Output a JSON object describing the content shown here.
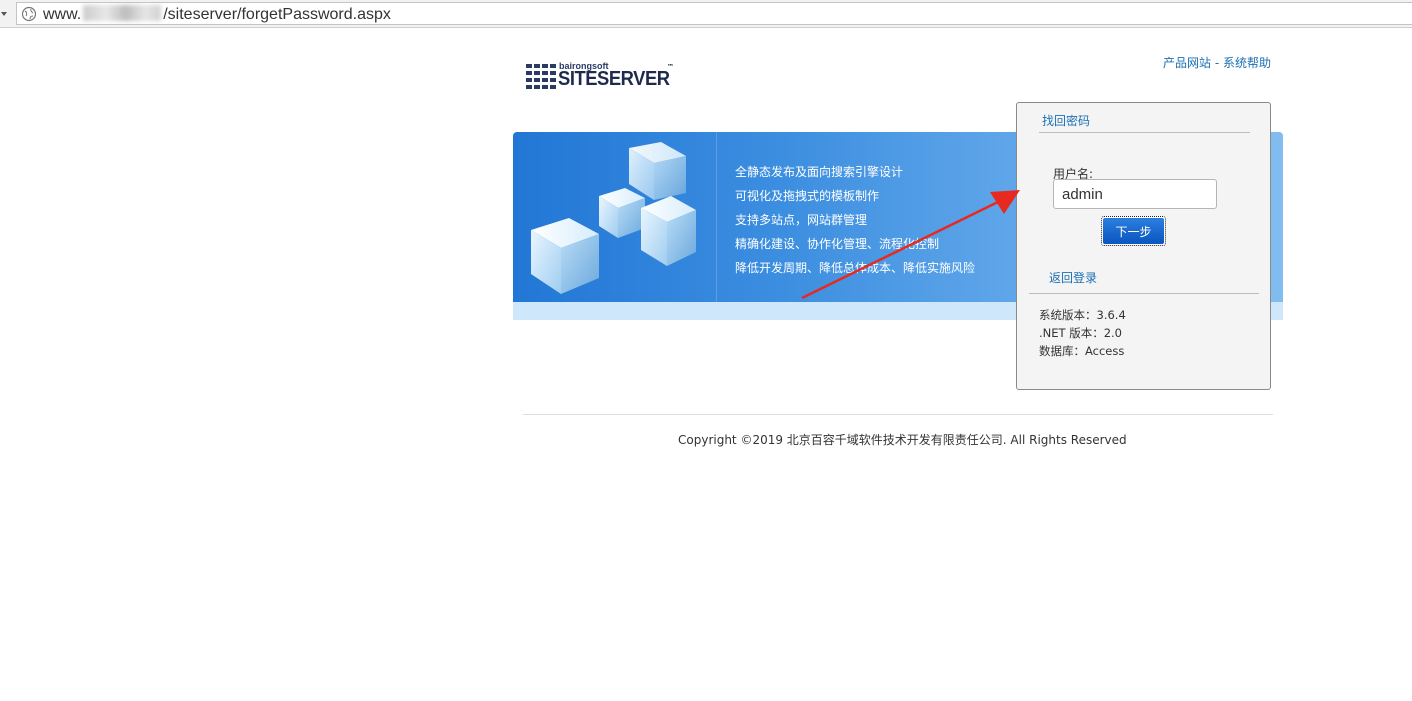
{
  "address_bar": {
    "url_prefix": "www.",
    "url_suffix": "/siteserver/forgetPassword.aspx"
  },
  "top_links": {
    "product_site": "产品网站",
    "separator": " - ",
    "system_help": "系统帮助"
  },
  "logo": {
    "small_text": "bairongsoft",
    "main_text": "SITESERVER",
    "trademark": "™"
  },
  "banner": {
    "features": [
      "全静态发布及面向搜索引擎设计",
      "可视化及拖拽式的模板制作",
      "支持多站点，网站群管理",
      "精确化建设、协作化管理、流程化控制",
      "降低开发周期、降低总体成本、降低实施风险"
    ]
  },
  "panel": {
    "title": "找回密码",
    "username_label": "用户名:",
    "username_value": "admin",
    "next_button": "下一步",
    "back_link": "返回登录",
    "info": {
      "system_version": "系统版本：3.6.4",
      "net_version": ".NET 版本：2.0",
      "database": "数据库：Access"
    }
  },
  "footer": {
    "copyright": "Copyright ©2019 北京百容千域软件技术开发有限责任公司. All Rights Reserved"
  },
  "colors": {
    "link": "#1a6fb5",
    "banner_start": "#2277d6",
    "banner_end": "#82bdf0",
    "button": "#0a55bf",
    "arrow": "#e8291f"
  }
}
